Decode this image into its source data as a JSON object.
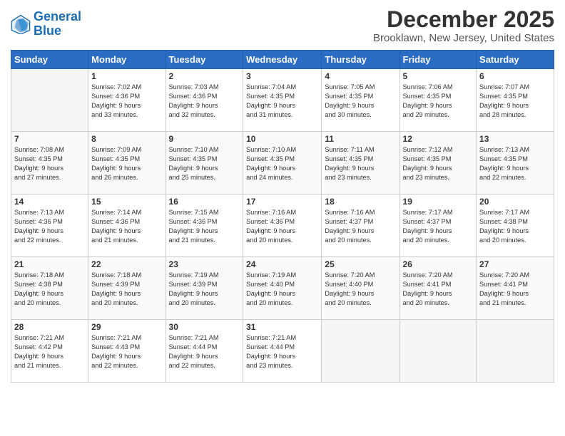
{
  "header": {
    "logo_line1": "General",
    "logo_line2": "Blue",
    "title": "December 2025",
    "subtitle": "Brooklawn, New Jersey, United States"
  },
  "days_of_week": [
    "Sunday",
    "Monday",
    "Tuesday",
    "Wednesday",
    "Thursday",
    "Friday",
    "Saturday"
  ],
  "weeks": [
    [
      {
        "day": "",
        "sunrise": "",
        "sunset": "",
        "daylight": "",
        "empty": true
      },
      {
        "day": "1",
        "sunrise": "Sunrise: 7:02 AM",
        "sunset": "Sunset: 4:36 PM",
        "daylight": "Daylight: 9 hours and 33 minutes."
      },
      {
        "day": "2",
        "sunrise": "Sunrise: 7:03 AM",
        "sunset": "Sunset: 4:36 PM",
        "daylight": "Daylight: 9 hours and 32 minutes."
      },
      {
        "day": "3",
        "sunrise": "Sunrise: 7:04 AM",
        "sunset": "Sunset: 4:35 PM",
        "daylight": "Daylight: 9 hours and 31 minutes."
      },
      {
        "day": "4",
        "sunrise": "Sunrise: 7:05 AM",
        "sunset": "Sunset: 4:35 PM",
        "daylight": "Daylight: 9 hours and 30 minutes."
      },
      {
        "day": "5",
        "sunrise": "Sunrise: 7:06 AM",
        "sunset": "Sunset: 4:35 PM",
        "daylight": "Daylight: 9 hours and 29 minutes."
      },
      {
        "day": "6",
        "sunrise": "Sunrise: 7:07 AM",
        "sunset": "Sunset: 4:35 PM",
        "daylight": "Daylight: 9 hours and 28 minutes."
      }
    ],
    [
      {
        "day": "7",
        "sunrise": "Sunrise: 7:08 AM",
        "sunset": "Sunset: 4:35 PM",
        "daylight": "Daylight: 9 hours and 27 minutes."
      },
      {
        "day": "8",
        "sunrise": "Sunrise: 7:09 AM",
        "sunset": "Sunset: 4:35 PM",
        "daylight": "Daylight: 9 hours and 26 minutes."
      },
      {
        "day": "9",
        "sunrise": "Sunrise: 7:10 AM",
        "sunset": "Sunset: 4:35 PM",
        "daylight": "Daylight: 9 hours and 25 minutes."
      },
      {
        "day": "10",
        "sunrise": "Sunrise: 7:10 AM",
        "sunset": "Sunset: 4:35 PM",
        "daylight": "Daylight: 9 hours and 24 minutes."
      },
      {
        "day": "11",
        "sunrise": "Sunrise: 7:11 AM",
        "sunset": "Sunset: 4:35 PM",
        "daylight": "Daylight: 9 hours and 23 minutes."
      },
      {
        "day": "12",
        "sunrise": "Sunrise: 7:12 AM",
        "sunset": "Sunset: 4:35 PM",
        "daylight": "Daylight: 9 hours and 23 minutes."
      },
      {
        "day": "13",
        "sunrise": "Sunrise: 7:13 AM",
        "sunset": "Sunset: 4:35 PM",
        "daylight": "Daylight: 9 hours and 22 minutes."
      }
    ],
    [
      {
        "day": "14",
        "sunrise": "Sunrise: 7:13 AM",
        "sunset": "Sunset: 4:36 PM",
        "daylight": "Daylight: 9 hours and 22 minutes."
      },
      {
        "day": "15",
        "sunrise": "Sunrise: 7:14 AM",
        "sunset": "Sunset: 4:36 PM",
        "daylight": "Daylight: 9 hours and 21 minutes."
      },
      {
        "day": "16",
        "sunrise": "Sunrise: 7:15 AM",
        "sunset": "Sunset: 4:36 PM",
        "daylight": "Daylight: 9 hours and 21 minutes."
      },
      {
        "day": "17",
        "sunrise": "Sunrise: 7:16 AM",
        "sunset": "Sunset: 4:36 PM",
        "daylight": "Daylight: 9 hours and 20 minutes."
      },
      {
        "day": "18",
        "sunrise": "Sunrise: 7:16 AM",
        "sunset": "Sunset: 4:37 PM",
        "daylight": "Daylight: 9 hours and 20 minutes."
      },
      {
        "day": "19",
        "sunrise": "Sunrise: 7:17 AM",
        "sunset": "Sunset: 4:37 PM",
        "daylight": "Daylight: 9 hours and 20 minutes."
      },
      {
        "day": "20",
        "sunrise": "Sunrise: 7:17 AM",
        "sunset": "Sunset: 4:38 PM",
        "daylight": "Daylight: 9 hours and 20 minutes."
      }
    ],
    [
      {
        "day": "21",
        "sunrise": "Sunrise: 7:18 AM",
        "sunset": "Sunset: 4:38 PM",
        "daylight": "Daylight: 9 hours and 20 minutes."
      },
      {
        "day": "22",
        "sunrise": "Sunrise: 7:18 AM",
        "sunset": "Sunset: 4:39 PM",
        "daylight": "Daylight: 9 hours and 20 minutes."
      },
      {
        "day": "23",
        "sunrise": "Sunrise: 7:19 AM",
        "sunset": "Sunset: 4:39 PM",
        "daylight": "Daylight: 9 hours and 20 minutes."
      },
      {
        "day": "24",
        "sunrise": "Sunrise: 7:19 AM",
        "sunset": "Sunset: 4:40 PM",
        "daylight": "Daylight: 9 hours and 20 minutes."
      },
      {
        "day": "25",
        "sunrise": "Sunrise: 7:20 AM",
        "sunset": "Sunset: 4:40 PM",
        "daylight": "Daylight: 9 hours and 20 minutes."
      },
      {
        "day": "26",
        "sunrise": "Sunrise: 7:20 AM",
        "sunset": "Sunset: 4:41 PM",
        "daylight": "Daylight: 9 hours and 20 minutes."
      },
      {
        "day": "27",
        "sunrise": "Sunrise: 7:20 AM",
        "sunset": "Sunset: 4:41 PM",
        "daylight": "Daylight: 9 hours and 21 minutes."
      }
    ],
    [
      {
        "day": "28",
        "sunrise": "Sunrise: 7:21 AM",
        "sunset": "Sunset: 4:42 PM",
        "daylight": "Daylight: 9 hours and 21 minutes."
      },
      {
        "day": "29",
        "sunrise": "Sunrise: 7:21 AM",
        "sunset": "Sunset: 4:43 PM",
        "daylight": "Daylight: 9 hours and 22 minutes."
      },
      {
        "day": "30",
        "sunrise": "Sunrise: 7:21 AM",
        "sunset": "Sunset: 4:44 PM",
        "daylight": "Daylight: 9 hours and 22 minutes."
      },
      {
        "day": "31",
        "sunrise": "Sunrise: 7:21 AM",
        "sunset": "Sunset: 4:44 PM",
        "daylight": "Daylight: 9 hours and 23 minutes."
      },
      {
        "day": "",
        "sunrise": "",
        "sunset": "",
        "daylight": "",
        "empty": true
      },
      {
        "day": "",
        "sunrise": "",
        "sunset": "",
        "daylight": "",
        "empty": true
      },
      {
        "day": "",
        "sunrise": "",
        "sunset": "",
        "daylight": "",
        "empty": true
      }
    ]
  ]
}
